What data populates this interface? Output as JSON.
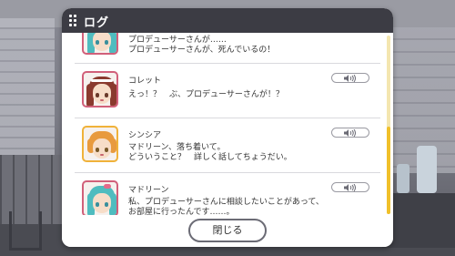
{
  "window": {
    "title": "ログ"
  },
  "entries": [
    {
      "name": "",
      "line1": "プロデューサーさんが……",
      "line2": "プロデューサーさんが、死んでいるの！",
      "has_voice": false,
      "frame_color": "#d1607a",
      "hair_color": "#4fbcbf",
      "eye_color": "#3a8f9c"
    },
    {
      "name": "コレット",
      "line1": "えっ！？　ぶ、プロデューサーさんが！？",
      "line2": "",
      "has_voice": true,
      "frame_color": "#d1607a",
      "hair_color": "#8a3a2e",
      "eye_color": "#6a3a2a"
    },
    {
      "name": "シンシア",
      "line1": "マドリーン、落ち着いて。",
      "line2": "どういうこと？　詳しく話してちょうだい。",
      "has_voice": true,
      "frame_color": "#f0b23a",
      "hair_color": "#e89a3e",
      "eye_color": "#7a5a2a"
    },
    {
      "name": "マドリーン",
      "line1": "私、プロデューサーさんに相談したいことがあって、",
      "line2": "お部屋に行ったんです……。",
      "has_voice": true,
      "frame_color": "#d1607a",
      "hair_color": "#4fbcbf",
      "eye_color": "#3a8f9c"
    }
  ],
  "voice_icon": "speaker-icon",
  "footer": {
    "close_label": "閉じる"
  },
  "colors": {
    "header_bg": "#3c3c44",
    "scroll_thumb": "#f0c02a",
    "panel_bg": "#ffffff"
  }
}
